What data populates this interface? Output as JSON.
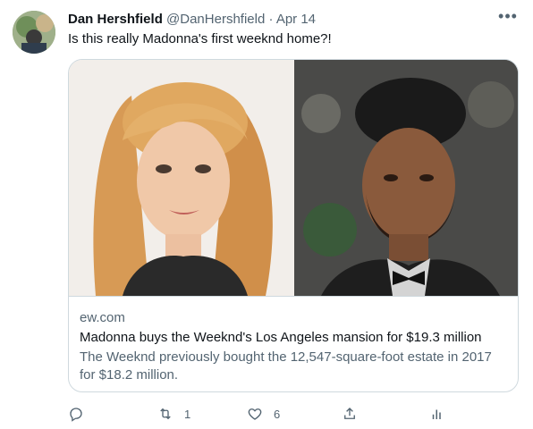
{
  "tweet": {
    "author_name": "Dan Hershfield",
    "handle": "@DanHershfield",
    "separator": "·",
    "date": "Apr 14",
    "text": "Is this really Madonna's first weeknd home?!",
    "more_icon": "more-horizontal-icon"
  },
  "card": {
    "domain": "ew.com",
    "title": "Madonna buys the Weeknd's Los Angeles mansion for $19.3 million",
    "description": "The Weeknd previously bought the 12,547-square-foot estate in 2017 for $18.2 million."
  },
  "actions": {
    "reply": {
      "icon": "reply-icon",
      "count": ""
    },
    "retweet": {
      "icon": "retweet-icon",
      "count": "1"
    },
    "like": {
      "icon": "heart-icon",
      "count": "6"
    },
    "share": {
      "icon": "share-icon",
      "count": ""
    },
    "analytics": {
      "icon": "analytics-icon",
      "count": ""
    }
  },
  "colors": {
    "text": "#0f1419",
    "secondary": "#536471",
    "border": "#cfd9de"
  }
}
